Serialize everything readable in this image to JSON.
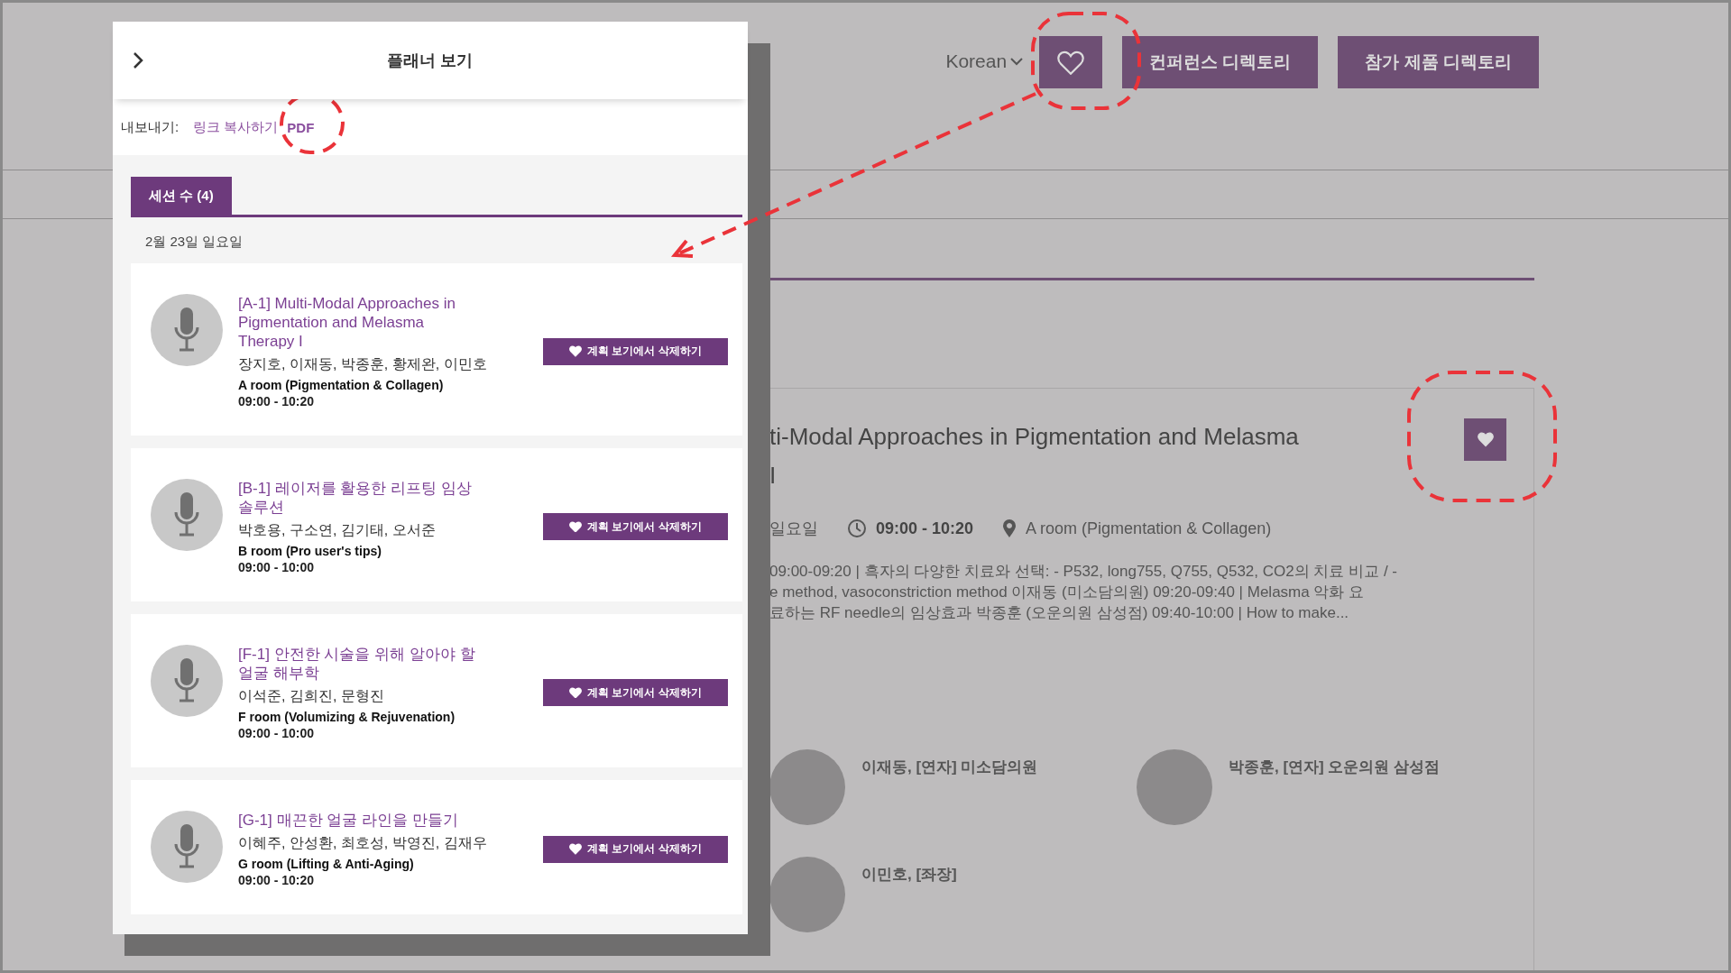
{
  "background_page": {
    "language": "Korean",
    "nav_buttons": [
      "컨퍼런스 디렉토리",
      "참가 제품 디렉토리"
    ],
    "session": {
      "title_lines": [
        "ti-Modal Approaches in Pigmentation and Melasma",
        "I"
      ],
      "day": "일요일",
      "time": "09:00 - 10:20",
      "room": "A room (Pigmentation & Collagen)",
      "description_lines": [
        "09:00-09:20 | 흑자의 다양한 치료와 선택: - P532, long755, Q755, Q532, CO2의 치료 비교 / -",
        "e method, vasoconstriction method  이재동 (미소담의원) 09:20-09:40 | Melasma 악화 요",
        "료하는 RF needle의 임상효과  박종훈 (오운의원 삼성점) 09:40-10:00 | How to make..."
      ],
      "speakers": [
        {
          "name": "이재동, [연자] 미소담의원"
        },
        {
          "name": "박종훈, [연자] 오운의원 삼성점"
        },
        {
          "name": "이민호, [좌장]"
        }
      ]
    }
  },
  "planner": {
    "title": "플래너 보기",
    "export_label": "내보내기:",
    "export_links": [
      "링크 복사하기",
      "PDF"
    ],
    "tabs": [
      {
        "label": "세션 수 (4)",
        "selected": true
      }
    ],
    "date": "2월 23일 일요일",
    "sessions": [
      {
        "title": "[A-1] Multi-Modal Approaches in Pigmentation and Melasma Therapy I",
        "speakers": "장지호, 이재동, 박종훈, 황제완, 이민호",
        "room": "A room (Pigmentation & Collagen)",
        "time": "09:00 - 10:20",
        "button": "계획 보기에서 삭제하기"
      },
      {
        "title": "[B-1] 레이저를 활용한 리프팅 임상 솔루션",
        "speakers": "박호용, 구소연, 김기태, 오서준",
        "room": "B room (Pro user's tips)",
        "time": "09:00 - 10:00",
        "button": "계획 보기에서 삭제하기"
      },
      {
        "title": "[F-1] 안전한 시술을 위해 알아야 할 얼굴 해부학",
        "speakers": "이석준, 김희진, 문형진",
        "room": "F room (Volumizing & Rejuvenation)",
        "time": "09:00 - 10:00",
        "button": "계획 보기에서 삭제하기"
      },
      {
        "title": "[G-1] 매끈한 얼굴 라인을 만들기",
        "speakers": "이혜주, 안성환, 최호성, 박영진, 김재우",
        "room": "G room (Lifting & Anti-Aging)",
        "time": "09:00 - 10:20",
        "button": "계획 보기에서 삭제하기"
      }
    ]
  }
}
